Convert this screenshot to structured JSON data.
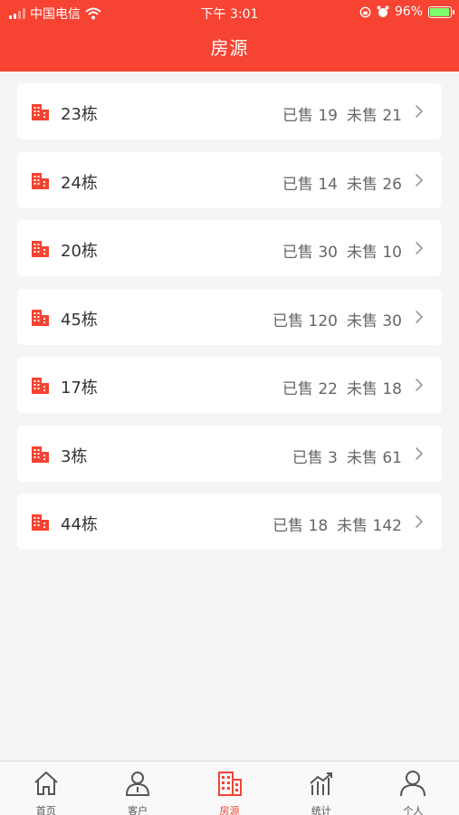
{
  "status_bar": {
    "carrier": "中国电信",
    "time": "下午 3:01",
    "battery": "96%",
    "battery_level": 0.96
  },
  "header": {
    "title": "房源"
  },
  "buildings": [
    {
      "name": "23栋",
      "sold_label": "已售",
      "sold": "19",
      "unsold_label": "未售",
      "unsold": "21"
    },
    {
      "name": "24栋",
      "sold_label": "已售",
      "sold": "14",
      "unsold_label": "未售",
      "unsold": "26"
    },
    {
      "name": "20栋",
      "sold_label": "已售",
      "sold": "30",
      "unsold_label": "未售",
      "unsold": "10"
    },
    {
      "name": "45栋",
      "sold_label": "已售",
      "sold": "120",
      "unsold_label": "未售",
      "unsold": "30"
    },
    {
      "name": "17栋",
      "sold_label": "已售",
      "sold": "22",
      "unsold_label": "未售",
      "unsold": "18"
    },
    {
      "name": "3栋",
      "sold_label": "已售",
      "sold": "3",
      "unsold_label": "未售",
      "unsold": "61"
    },
    {
      "name": "44栋",
      "sold_label": "已售",
      "sold": "18",
      "unsold_label": "未售",
      "unsold": "142"
    }
  ],
  "tabbar": {
    "items": [
      {
        "label": "首页",
        "icon": "home-icon"
      },
      {
        "label": "客户",
        "icon": "customer-icon"
      },
      {
        "label": "房源",
        "icon": "building-icon",
        "active": true
      },
      {
        "label": "统计",
        "icon": "stats-icon"
      },
      {
        "label": "个人",
        "icon": "person-icon"
      }
    ]
  },
  "colors": {
    "accent": "#f64332",
    "background": "#f5f5f5",
    "card": "#ffffff"
  }
}
